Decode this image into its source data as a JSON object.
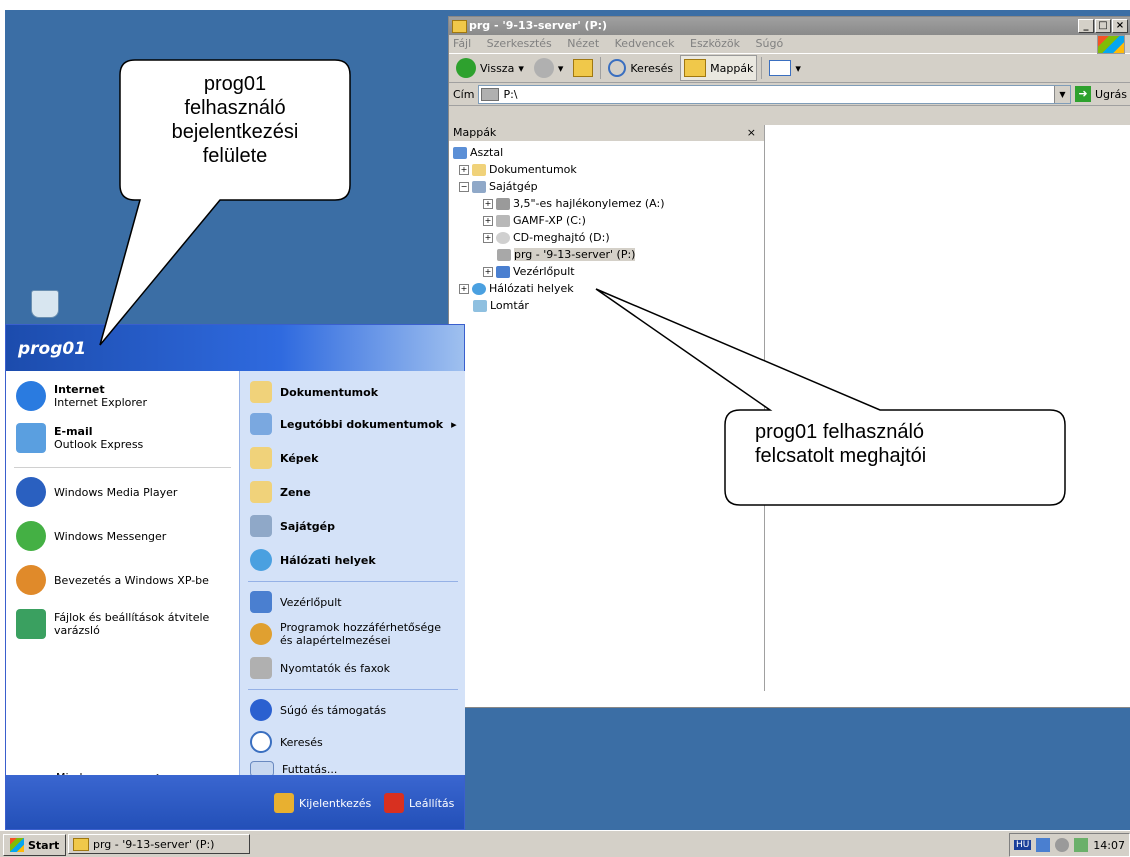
{
  "explorer": {
    "title": "prg - '9-13-server' (P:)",
    "menu": [
      "Fájl",
      "Szerkesztés",
      "Nézet",
      "Kedvencek",
      "Eszközök",
      "Súgó"
    ],
    "toolbar": {
      "back": "Vissza",
      "search": "Keresés",
      "folders": "Mappák"
    },
    "address_label": "Cím",
    "address_value": "P:\\",
    "go_label": "Ugrás",
    "folders_header": "Mappák",
    "close_glyph": "×",
    "tree": [
      {
        "label": "Asztal"
      },
      {
        "label": "Dokumentumok"
      },
      {
        "label": "Sajátgép"
      },
      {
        "label": "3,5\"-es hajlékonylemez (A:)"
      },
      {
        "label": "GAMF-XP (C:)"
      },
      {
        "label": "CD-meghajtó (D:)"
      },
      {
        "label": "prg - '9-13-server' (P:)"
      },
      {
        "label": "Vezérlőpult"
      },
      {
        "label": "Hálózati helyek"
      },
      {
        "label": "Lomtár"
      }
    ]
  },
  "startmenu": {
    "user": "prog01",
    "left": {
      "internet_title": "Internet",
      "internet_sub": "Internet Explorer",
      "email_title": "E-mail",
      "email_sub": "Outlook Express",
      "mediaplayer": "Windows Media Player",
      "messenger": "Windows Messenger",
      "tour": "Bevezetés a Windows XP-be",
      "transfer_1": "Fájlok és beállítások átvitele",
      "transfer_2": "varázsló",
      "all_programs": "Minden program"
    },
    "right": {
      "documents": "Dokumentumok",
      "recent": "Legutóbbi dokumentumok",
      "pictures": "Képek",
      "music": "Zene",
      "mycomputer": "Sajátgép",
      "network": "Hálózati helyek",
      "controlpanel": "Vezérlőpult",
      "programs_1": "Programok hozzáférhetősége",
      "programs_2": "és alapértelmezései",
      "printers": "Nyomtatók és faxok",
      "help": "Súgó és támogatás",
      "search": "Keresés",
      "run": "Futtatás..."
    },
    "logoff": "Kijelentkezés",
    "shutdown": "Leállítás"
  },
  "taskbar": {
    "start": "Start",
    "task": "prg - '9-13-server' (P:)",
    "lang": "HU",
    "clock": "14:07"
  },
  "callouts": {
    "login_lines": [
      "prog01",
      "felhasználó",
      "bejelentkezési",
      "felülete"
    ],
    "drives_lines": [
      "prog01 felhasználó",
      "felcsatolt meghajtói"
    ]
  }
}
